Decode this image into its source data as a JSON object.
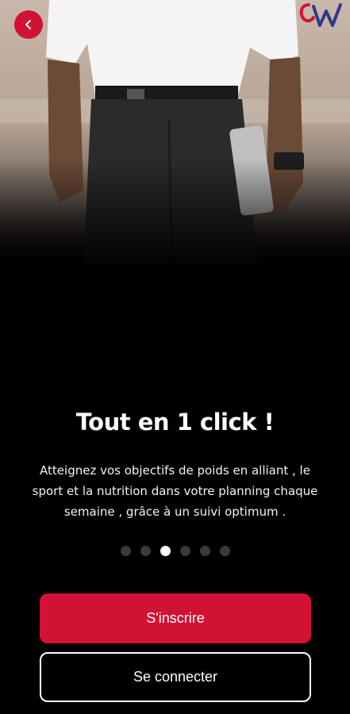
{
  "onboarding": {
    "title": "Tout en 1 click !",
    "description": "Atteignez vos objectifs de poids en alliant , le sport et la nutrition dans votre planning chaque semaine , grâce à un suivi optimum .",
    "pagination": {
      "total": 6,
      "active_index": 2
    }
  },
  "actions": {
    "signup_label": "S'inscrire",
    "login_label": "Se connecter"
  },
  "icons": {
    "back": "chevron-left-icon",
    "logo": "brand-logo"
  },
  "colors": {
    "accent": "#d21234",
    "background": "#000000",
    "dot_inactive": "#3a3a3a",
    "dot_active": "#ffffff"
  }
}
